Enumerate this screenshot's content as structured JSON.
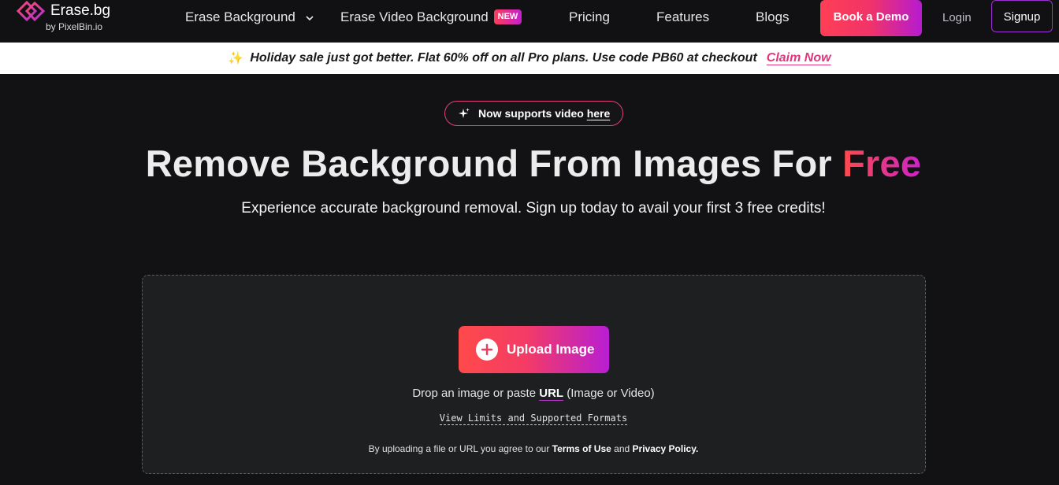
{
  "brand": {
    "name": "Erase.bg",
    "by": "by PixelBin.io"
  },
  "nav": {
    "erase_background": "Erase Background",
    "erase_video_background": "Erase Video Background",
    "new_badge": "NEW",
    "pricing": "Pricing",
    "features": "Features",
    "blogs": "Blogs",
    "book_demo": "Book a Demo",
    "login": "Login",
    "signup": "Signup"
  },
  "promo": {
    "emoji": "✨",
    "text": "Holiday sale just got better. Flat 60% off on all Pro plans. Use code PB60 at checkout",
    "cta": "Claim Now"
  },
  "hero": {
    "pill_text": "Now supports video ",
    "pill_link": "here",
    "title_main": "Remove Background From Images For ",
    "title_highlight": "Free",
    "subtitle": "Experience accurate background removal. Sign up today to avail your first 3 free credits!"
  },
  "upload": {
    "button_label": "Upload Image",
    "drop_prefix": "Drop an image or paste ",
    "drop_url": "URL",
    "drop_suffix": " (Image or Video)",
    "limits_link": "View Limits and Supported Formats",
    "terms_prefix": "By uploading a file or URL you agree to our ",
    "terms_link": "Terms of Use",
    "terms_and": " and ",
    "privacy_link": "Privacy Policy."
  },
  "colors": {
    "background": "#121214",
    "accent_start": "#ff4a4a",
    "accent_end": "#b81ed3",
    "promo_link": "#e4347e"
  },
  "icons": {
    "logo": "erase-bg-logo-icon",
    "dropdown": "chevron-down-icon",
    "pill": "sparkle-icon",
    "upload": "plus-circle-icon"
  }
}
